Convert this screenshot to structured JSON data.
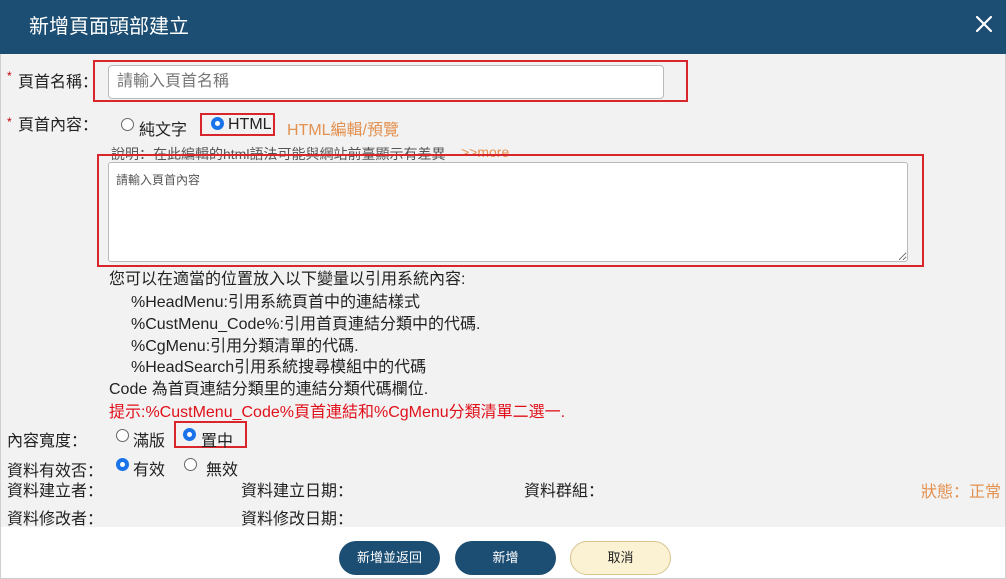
{
  "dialog": {
    "title": "新增頁面頭部建立",
    "close_icon": "close-icon"
  },
  "form": {
    "required_mark": "*",
    "header_name": {
      "label": "頁首名稱：",
      "placeholder": "請輸入頁首名稱",
      "value": ""
    },
    "header_content": {
      "label": "頁首內容：",
      "options": [
        {
          "label": "純文字",
          "selected": false
        },
        {
          "label": "HTML",
          "selected": true
        }
      ],
      "html_edit_link": "HTML編輯/預覽",
      "note": "說明：在此編輯的html語法可能與網站前臺顯示有差異",
      "more_link": ">>more",
      "placeholder": "請輸入頁首內容",
      "value": ""
    },
    "variables_help": {
      "intro": "您可以在適當的位置放入以下變量以引用系統內容:",
      "items": [
        "%HeadMenu:引用系統頁首中的連結樣式",
        "%CustMenu_Code%:引用首頁連結分類中的代碼.",
        "%CgMenu:引用分類清單的代碼.",
        "%HeadSearch引用系統搜尋模組中的代碼"
      ],
      "code_note": "Code 為首頁連結分類里的連結分類代碼欄位.",
      "tip": "提示:%CustMenu_Code%頁首連結和%CgMenu分類清單二選一."
    },
    "content_width": {
      "label": "內容寬度：",
      "options": [
        {
          "label": "滿版",
          "selected": false
        },
        {
          "label": "置中",
          "selected": true
        }
      ]
    },
    "valid": {
      "label": "資料有效否：",
      "options": [
        {
          "label": "有效",
          "selected": true
        },
        {
          "label": "無效",
          "selected": false
        }
      ]
    },
    "meta": {
      "creator_label": "資料建立者：",
      "created_date_label": "資料建立日期：",
      "group_label": "資料群組：",
      "status_text": "狀態：正常",
      "modifier_label": "資料修改者：",
      "modified_date_label": "資料修改日期："
    }
  },
  "footer": {
    "add_return": "新增並返回",
    "add": "新增",
    "cancel": "取消"
  },
  "colors": {
    "header_bg": "#1c4e73",
    "accent_orange": "#e39150",
    "tip_red": "#e0101a",
    "highlight_box": "#d8262c",
    "radio_selected": "#1a73e8"
  }
}
